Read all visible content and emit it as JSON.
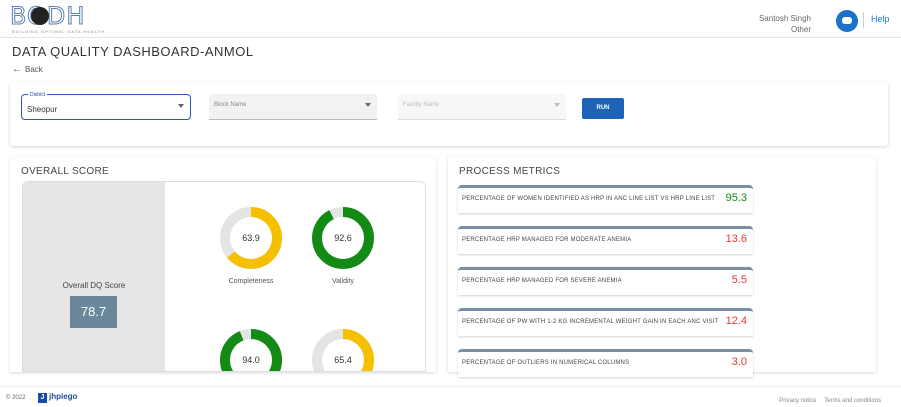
{
  "header": {
    "logo_text": "BODH",
    "logo_subtitle": "BUILDING OPTIMAL DATA HEALTH",
    "user_name": "Santosh Singh",
    "user_role": "Other",
    "help_label": "Help"
  },
  "page": {
    "title": "DATA QUALITY DASHBOARD-ANMOL",
    "back_label": "Back"
  },
  "filters": {
    "district": {
      "label": "District",
      "value": "Sheopur"
    },
    "block": {
      "placeholder": "Block Name"
    },
    "facility": {
      "placeholder": "Facility Name"
    },
    "run_label": "RUN"
  },
  "overall": {
    "title": "OVERALL SCORE",
    "score_label": "Overall DQ Score",
    "score_value": "78.7",
    "donuts": [
      {
        "label": "Completeness",
        "value": "63.9",
        "fraction": 0.639,
        "color": "#f5c000"
      },
      {
        "label": "Validity",
        "value": "92.6",
        "fraction": 0.926,
        "color": "#138a13"
      },
      {
        "label": "",
        "value": "94.0",
        "fraction": 0.94,
        "color": "#138a13"
      },
      {
        "label": "",
        "value": "65.4",
        "fraction": 0.654,
        "color": "#f5c000"
      }
    ]
  },
  "process": {
    "title": "PROCESS METRICS",
    "metrics": [
      {
        "label": "PERCENTAGE OF WOMEN IDENTIFIED AS HRP IN ANC LINE LIST VS HRP LINE LIST",
        "value": "95.3",
        "color": "#138a13"
      },
      {
        "label": "PERCENTAGE HRP MANAGED FOR MODERATE ANEMIA",
        "value": "13.6",
        "color": "#e53935"
      },
      {
        "label": "PERCENTAGE HRP MANAGED FOR SEVERE ANEMIA",
        "value": "5.5",
        "color": "#e53935"
      },
      {
        "label": "PERCENTAGE OF PW WITH 1-2 KG INCREMENTAL WEIGHT GAIN IN EACH ANC VISIT",
        "value": "12.4",
        "color": "#e53935"
      },
      {
        "label": "PERCENTAGE OF OUTLIERS IN NUMERICAL COLUMNS",
        "value": "3.0",
        "color": "#e53935"
      }
    ]
  },
  "footer": {
    "copyright": "© 2022",
    "org": "jhpiego",
    "privacy": "Privacy notice",
    "terms": "Terms and conditions"
  }
}
